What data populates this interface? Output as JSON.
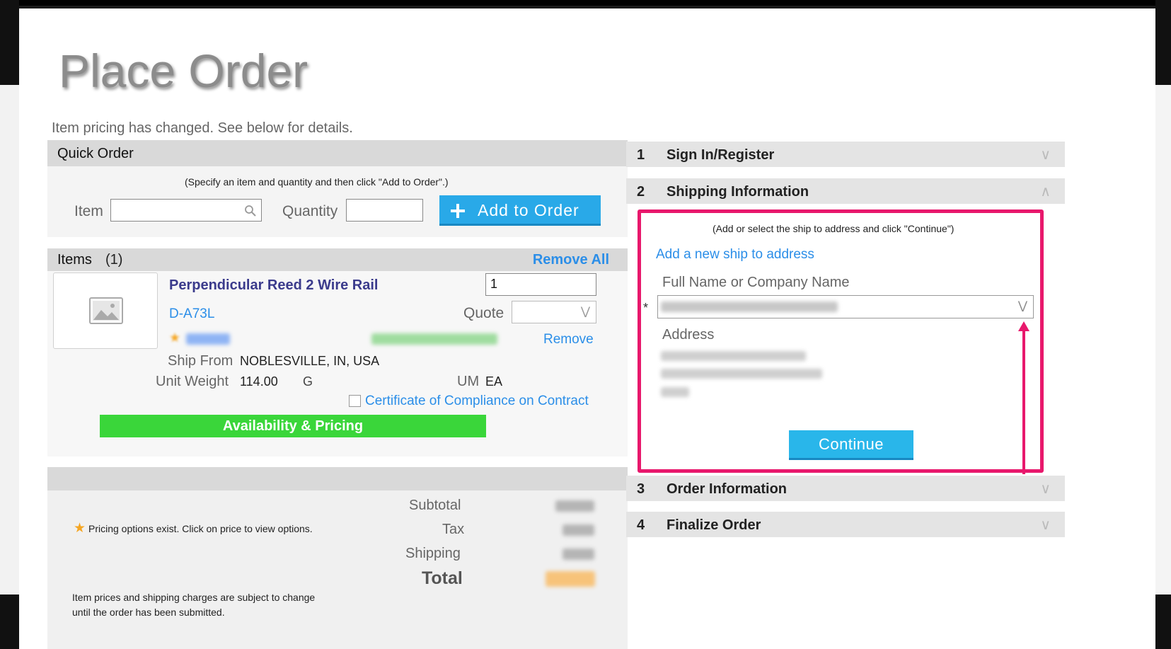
{
  "page": {
    "title": "Place Order",
    "notice": "Item pricing has changed. See below for details."
  },
  "quick_order": {
    "title": "Quick Order",
    "hint": "(Specify an item and quantity and then click \"Add to Order\".)",
    "item_label": "Item",
    "item_value": "",
    "quantity_label": "Quantity",
    "quantity_value": "",
    "add_button": "Add to Order"
  },
  "items": {
    "title": "Items",
    "count": "(1)",
    "remove_all": "Remove All",
    "list": [
      {
        "name": "Perpendicular Reed 2 Wire Rail",
        "code": "D-A73L",
        "quantity": "1",
        "quote_label": "Quote",
        "remove": "Remove",
        "ship_from_label": "Ship From",
        "ship_from": "NOBLESVILLE, IN, USA",
        "unit_weight_label": "Unit Weight",
        "unit_weight": "114.00",
        "weight_unit": "G",
        "um_label": "UM",
        "um": "EA",
        "certificate": "Certificate of Compliance on Contract",
        "availability_button": "Availability & Pricing"
      }
    ]
  },
  "summary": {
    "pricing_note": "Pricing options exist. Click on price to view options.",
    "subtotal_label": "Subtotal",
    "tax_label": "Tax",
    "shipping_label": "Shipping",
    "total_label": "Total",
    "disclaimer_line1": "Item prices and shipping charges are subject to change",
    "disclaimer_line2": "until the order has been submitted."
  },
  "steps": [
    {
      "num": "1",
      "name": "Sign In/Register",
      "icon": "chevron-down-icon"
    },
    {
      "num": "2",
      "name": "Shipping Information",
      "icon": "chevron-up-icon"
    },
    {
      "num": "3",
      "name": "Order Information",
      "icon": "chevron-down-icon"
    },
    {
      "num": "4",
      "name": "Finalize Order",
      "icon": "chevron-down-icon"
    }
  ],
  "shipping": {
    "hint": "(Add or select the ship to address and click \"Continue\")",
    "add_link": "Add a new ship to address",
    "name_label": "Full Name or Company Name",
    "required_mark": "*",
    "address_label": "Address",
    "continue_button": "Continue"
  },
  "colors": {
    "accent_blue": "#29a9e8",
    "link_blue": "#2b8ee8",
    "availability_green": "#3ad63a",
    "highlight_pink": "#e8186c",
    "item_name": "#3b3b8c"
  }
}
